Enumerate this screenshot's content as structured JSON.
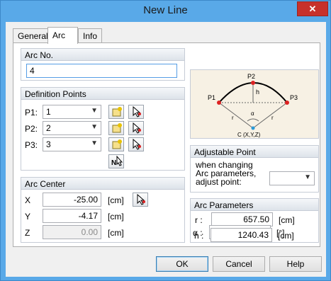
{
  "window": {
    "title": "New Line",
    "close_glyph": "✕"
  },
  "tabs": [
    {
      "label": "General"
    },
    {
      "label": "Arc",
      "active": true
    },
    {
      "label": "Info"
    }
  ],
  "arc_no": {
    "header": "Arc No.",
    "value": "4"
  },
  "definition_points": {
    "header": "Definition Points",
    "rows": [
      {
        "label": "P1:",
        "value": "1"
      },
      {
        "label": "P2:",
        "value": "2"
      },
      {
        "label": "P3:",
        "value": "3"
      }
    ]
  },
  "diagram": {
    "p1": "P1",
    "p2": "P2",
    "p3": "P3",
    "h": "h",
    "r_left": "r",
    "r_right": "r",
    "alpha": "α",
    "center": "C (X,Y,Z)"
  },
  "adjustable_point": {
    "header": "Adjustable Point",
    "line1": "when changing",
    "line2": "Arc parameters,",
    "line3": "adjust point:",
    "value": ""
  },
  "arc_center": {
    "header": "Arc Center",
    "rows": [
      {
        "label": "X",
        "value": "-25.00",
        "unit": "[cm]",
        "disabled": false
      },
      {
        "label": "Y",
        "value": "-4.17",
        "unit": "[cm]",
        "disabled": false
      },
      {
        "label": "Z",
        "value": "0.00",
        "unit": "[cm]",
        "disabled": true
      }
    ]
  },
  "arc_parameters": {
    "header": "Arc Parameters",
    "rows": [
      {
        "label": "r :",
        "value": "657.50",
        "unit": "[cm]"
      },
      {
        "label": "h :",
        "value": "1240.43",
        "unit": "[cm]"
      },
      {
        "label": "α :",
        "value": "304.89",
        "unit": "[°]"
      }
    ]
  },
  "buttons": {
    "ok": "OK",
    "cancel": "Cancel",
    "help": "Help"
  }
}
